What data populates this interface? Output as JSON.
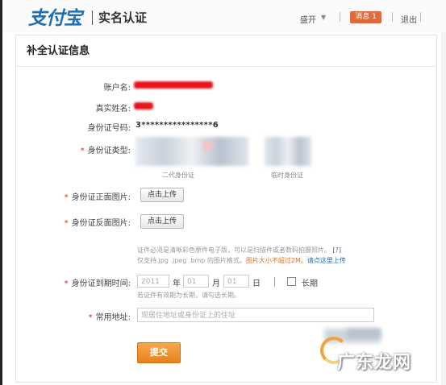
{
  "header": {
    "logo_text": "支付宝",
    "logo_subtitle": "实名认证",
    "user_name": "盛开",
    "messages_badge": "消息 1",
    "logout_label": "退出"
  },
  "page": {
    "title": "补全认证信息"
  },
  "form": {
    "account_label": "账户名:",
    "account_value_redacted": "********@qq.com",
    "real_name_label": "真实姓名:",
    "real_name_value_redacted": "**",
    "id_number_label": "身份证号码:",
    "id_number_value": "3****************6",
    "id_type_label": "身份证类型:",
    "id_type_options": [
      {
        "caption": "二代身份证"
      },
      {
        "caption": "临时身份证"
      }
    ],
    "front_image_label": "身份证正面图片:",
    "front_upload_button": "点击上传",
    "back_image_label": "身份证反面图片:",
    "back_upload_button": "点击上传",
    "upload_note_line1": "证件必须是清晰彩色原件电子版，可以是扫描件或者数码拍摄照片。",
    "upload_note_help": "[?]",
    "upload_note_line2_prefix": "仅支持.jpg .jpeg .bmp 的图片格式。",
    "upload_note_size": "图片大小不超过2M。",
    "upload_note_link": "请点这里上传",
    "expiry_label": "身份证到期时间:",
    "expiry_year_placeholder": "2011",
    "expiry_year_unit": "年",
    "expiry_month_placeholder": "01",
    "expiry_month_unit": "月",
    "expiry_day_placeholder": "01",
    "expiry_day_unit": "日",
    "expiry_longterm_label": "长期",
    "expiry_note": "若证件有效期为长期，请勾选长期。",
    "address_label": "常用地址:",
    "address_placeholder": "现居住地址或身份证上的住址",
    "submit_label": "提交"
  },
  "watermark": {
    "text": "广东龙网"
  },
  "colors": {
    "accent_orange": "#e8811d",
    "required_red": "#d9261c",
    "link_blue": "#2c6bb3",
    "logo_blue": "#1f6fb5"
  }
}
